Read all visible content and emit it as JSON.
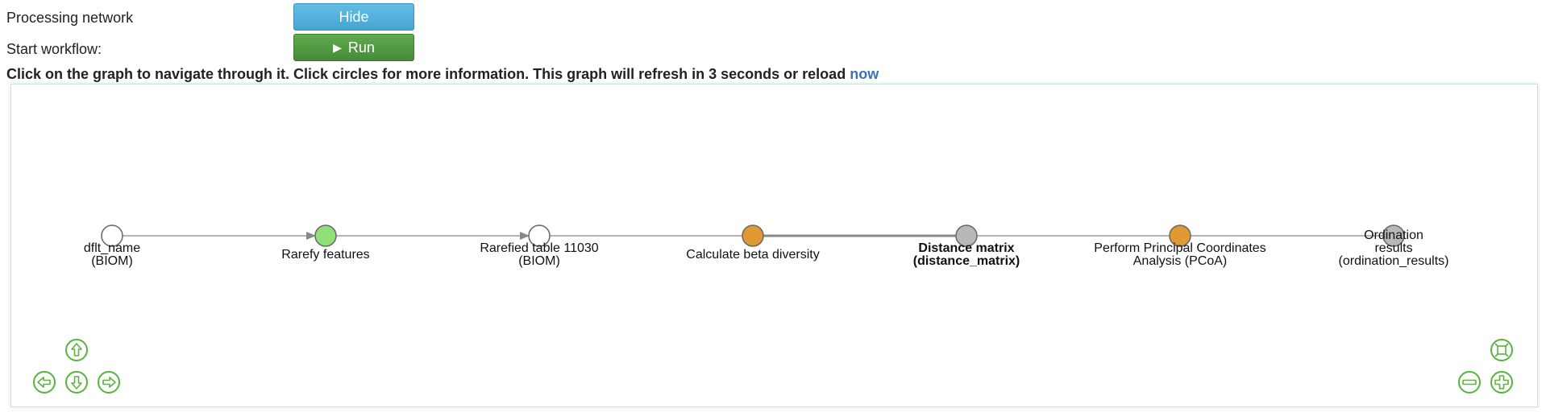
{
  "controls": {
    "processing_label": "Processing network",
    "hide_label": "Hide",
    "start_label": "Start workflow:",
    "run_label": "Run"
  },
  "instructions": {
    "text": "Click on the graph to navigate through it. Click circles for more information. This graph will refresh in 3 seconds or reload ",
    "link": "now"
  },
  "colors": {
    "artifact_empty": "#ffffff",
    "process_success": "#90e07a",
    "process_running": "#e09a33",
    "artifact_pending": "#b8b8b8",
    "edge": "#888888",
    "nav_icon": "#59b33e"
  },
  "graph": {
    "nodes": [
      {
        "id": "n1",
        "kind": "artifact",
        "status": "done",
        "color": "#ffffff",
        "lines": [
          "dflt_name",
          "(BIOM)"
        ],
        "bold": false
      },
      {
        "id": "n2",
        "kind": "process",
        "status": "success",
        "color": "#90e07a",
        "lines": [
          "Rarefy features"
        ],
        "bold": false
      },
      {
        "id": "n3",
        "kind": "artifact",
        "status": "done",
        "color": "#ffffff",
        "lines": [
          "Rarefied table 11030",
          "(BIOM)"
        ],
        "bold": false
      },
      {
        "id": "n4",
        "kind": "process",
        "status": "running",
        "color": "#e09a33",
        "lines": [
          "Calculate beta diversity"
        ],
        "bold": false
      },
      {
        "id": "n5",
        "kind": "artifact",
        "status": "pending",
        "color": "#b8b8b8",
        "lines": [
          "Distance matrix",
          "(distance_matrix)"
        ],
        "bold": true
      },
      {
        "id": "n6",
        "kind": "process",
        "status": "running",
        "color": "#e09a33",
        "lines": [
          "Perform Principal Coordinates",
          "Analysis (PCoA)"
        ],
        "bold": false
      },
      {
        "id": "n7",
        "kind": "artifact",
        "status": "pending",
        "color": "#b8b8b8",
        "lines": [
          "Ordination",
          "results",
          "(ordination_results)"
        ],
        "bold": false
      }
    ],
    "edges": [
      {
        "from": "n1",
        "to": "n2",
        "arrow": true,
        "thick": false
      },
      {
        "from": "n2",
        "to": "n3",
        "arrow": true,
        "thick": false
      },
      {
        "from": "n3",
        "to": "n4",
        "arrow": false,
        "thick": false
      },
      {
        "from": "n4",
        "to": "n5",
        "arrow": false,
        "thick": true
      },
      {
        "from": "n5",
        "to": "n6",
        "arrow": false,
        "thick": false
      },
      {
        "from": "n6",
        "to": "n7",
        "arrow": false,
        "thick": false
      }
    ]
  },
  "nav_icons": [
    "arrow-up-icon",
    "arrow-left-icon",
    "arrow-down-icon",
    "arrow-right-icon",
    "fit-view-icon",
    "zoom-out-icon",
    "zoom-in-icon"
  ]
}
